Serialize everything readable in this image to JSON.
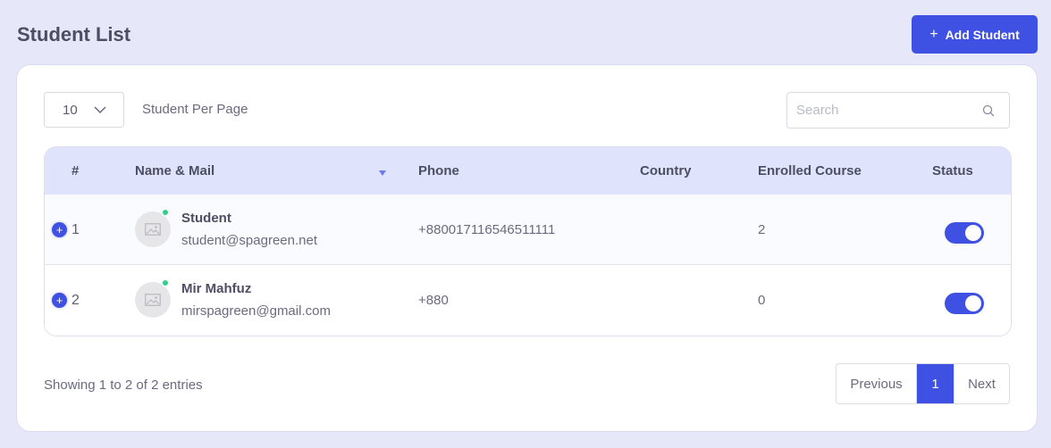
{
  "header": {
    "title": "Student List",
    "add_button_label": "Add Student",
    "add_button_icon": "plus-icon"
  },
  "controls": {
    "per_page_value": "10",
    "per_page_label": "Student Per Page",
    "search_placeholder": "Search",
    "search_value": ""
  },
  "table": {
    "columns": [
      "#",
      "Name & Mail",
      "Phone",
      "Country",
      "Enrolled Course",
      "Status"
    ],
    "rows": [
      {
        "num": "1",
        "name": "Student",
        "email": "student@spagreen.net",
        "phone": "+880017116546511111",
        "country": "",
        "enrolled": "2",
        "status": true
      },
      {
        "num": "2",
        "name": "Mir Mahfuz",
        "email": "mirspagreen@gmail.com",
        "phone": "+880",
        "country": "",
        "enrolled": "0",
        "status": true
      }
    ]
  },
  "footer": {
    "entries_text": "Showing 1 to 2 of 2 entries",
    "prev_label": "Previous",
    "current_page": "1",
    "next_label": "Next"
  },
  "colors": {
    "accent": "#3f51e3",
    "background": "#e6e7f8",
    "table_header": "#dfe3fb",
    "online": "#2fd08a"
  }
}
